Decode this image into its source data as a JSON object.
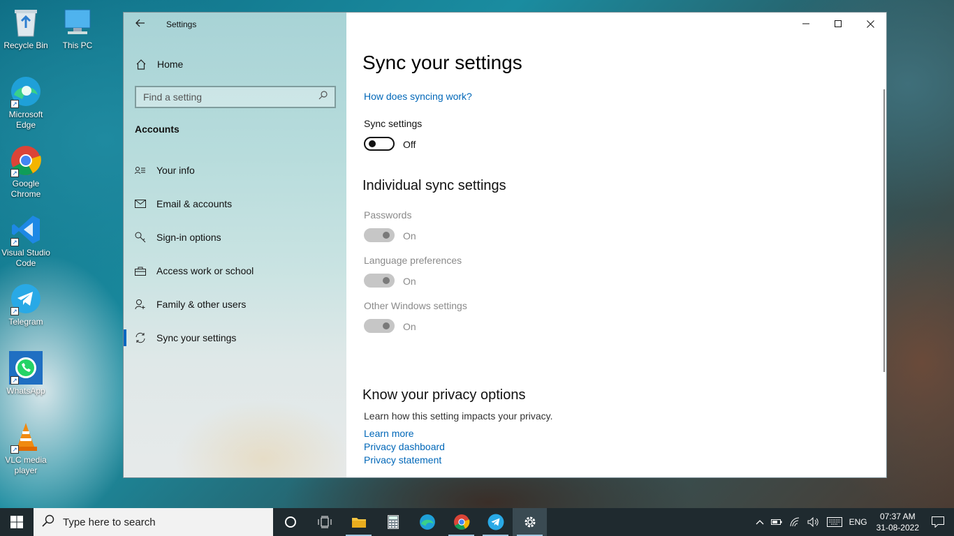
{
  "desktop": {
    "icons": [
      {
        "label": "Recycle Bin"
      },
      {
        "label": "This PC"
      },
      {
        "label": "Microsoft Edge"
      },
      {
        "label": "Google Chrome"
      },
      {
        "label": "Visual Studio Code"
      },
      {
        "label": "Telegram"
      },
      {
        "label": "WhatsApp"
      },
      {
        "label": "VLC media player"
      }
    ]
  },
  "window": {
    "title": "Settings",
    "nav": {
      "home_label": "Home",
      "search_placeholder": "Find a setting",
      "section_title": "Accounts",
      "items": [
        {
          "label": "Your info",
          "icon": "contact-card-icon"
        },
        {
          "label": "Email & accounts",
          "icon": "mail-icon"
        },
        {
          "label": "Sign-in options",
          "icon": "key-icon"
        },
        {
          "label": "Access work or school",
          "icon": "briefcase-icon"
        },
        {
          "label": "Family & other users",
          "icon": "add-person-icon"
        },
        {
          "label": "Sync your settings",
          "icon": "sync-icon",
          "active": true
        }
      ]
    },
    "content": {
      "page_title": "Sync your settings",
      "how_link": "How does syncing work?",
      "sync_settings": {
        "label": "Sync settings",
        "state": "Off"
      },
      "individual_title": "Individual sync settings",
      "individual": [
        {
          "label": "Passwords",
          "state": "On"
        },
        {
          "label": "Language preferences",
          "state": "On"
        },
        {
          "label": "Other Windows settings",
          "state": "On"
        }
      ],
      "privacy": {
        "title": "Know your privacy options",
        "description": "Learn how this setting impacts your privacy.",
        "links": [
          "Learn more",
          "Privacy dashboard",
          "Privacy statement"
        ]
      }
    }
  },
  "taskbar": {
    "search_placeholder": "Type here to search",
    "language": "ENG",
    "time": "07:37 AM",
    "date": "31-08-2022"
  },
  "colors": {
    "accent": "#0067c0",
    "link": "#0067b8",
    "taskbar": "#1f2a2f"
  }
}
